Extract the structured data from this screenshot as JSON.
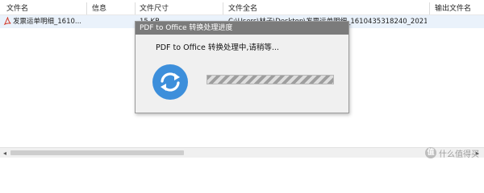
{
  "columns": {
    "file_name": "文件名",
    "info": "信息",
    "file_size": "文件尺寸",
    "full_name": "文件全名",
    "output_name": "输出文件名"
  },
  "rows": [
    {
      "file_name": "发票运单明细_1610...",
      "info": "",
      "file_size": "15 KB",
      "full_name": "C:\\Users\\林子\\Desktop\\发票运单明细_1610435318240_2021...",
      "output_name": ""
    }
  ],
  "dialog": {
    "title": "PDF to Office 转换处理进度",
    "message": "PDF to Office 转换处理中,请稍等...",
    "progress": 1.0
  },
  "watermark": {
    "text": "什么值得买",
    "logo_text": "值"
  },
  "colors": {
    "dialog_title_bg": "#7b7b7b",
    "convert_icon": "#3d8fdb",
    "row_selected": "#eaf2fb"
  }
}
